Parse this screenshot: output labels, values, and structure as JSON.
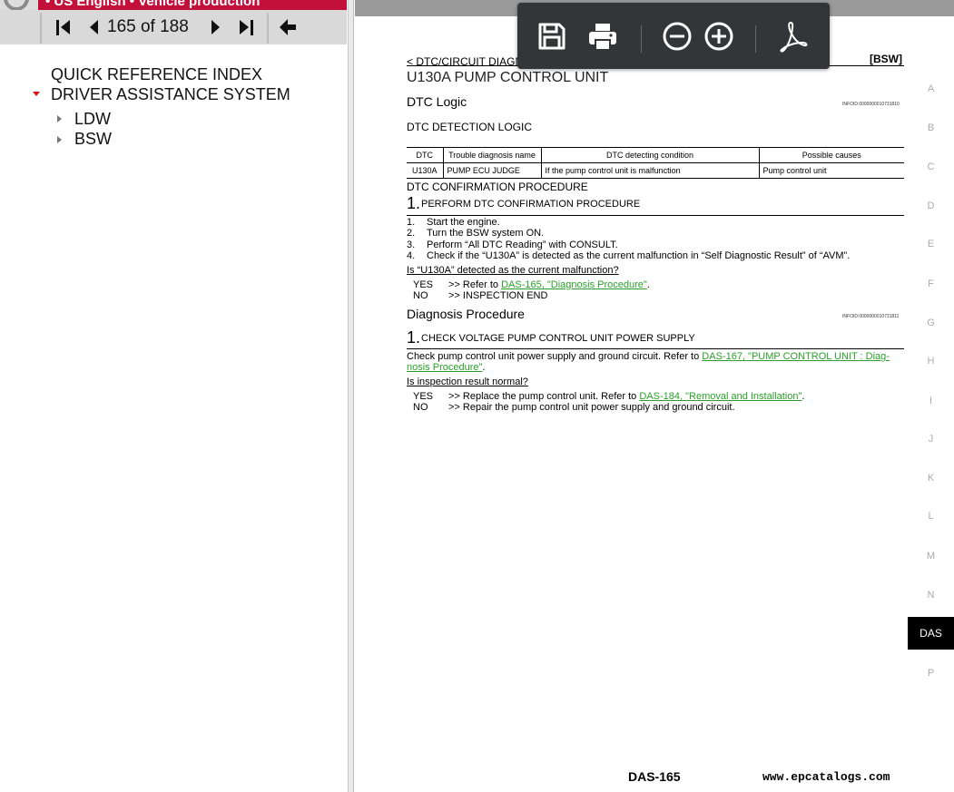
{
  "app": {
    "banner_text": "• US English • Vehicle production",
    "logo_icon": "nissan-logo"
  },
  "nav": {
    "first_icon": "first-page-icon",
    "prev_icon": "prev-page-icon",
    "page_indicator": "165 of 188",
    "next_icon": "next-page-icon",
    "last_icon": "last-page-icon",
    "back_icon": "back-arrow-icon"
  },
  "tree": {
    "items": [
      {
        "label": "QUICK REFERENCE INDEX"
      },
      {
        "label": "DRIVER ASSISTANCE SYSTEM",
        "expanded": true
      },
      {
        "label": "LDW"
      },
      {
        "label": "BSW"
      }
    ]
  },
  "toolbar": {
    "save_icon": "save-icon",
    "print_icon": "print-icon",
    "zoom_out_icon": "zoom-out-icon",
    "zoom_in_icon": "zoom-in-icon",
    "pdf_icon": "acrobat-icon"
  },
  "doc": {
    "breadcrumb": "< DTC/CIRCUIT DIAGNOSIS >",
    "section_tag": "[BSW]",
    "title": "U130A PUMP CONTROL UNIT",
    "dtc_logic": "DTC Logic",
    "infoid1": "INFOID:0000000010731810",
    "dtc_detection_logic": "DTC DETECTION LOGIC",
    "table": {
      "headers": [
        "DTC",
        "Trouble diagnosis name",
        "DTC detecting condition",
        "Possible causes"
      ],
      "rows": [
        [
          "U130A",
          "PUMP ECU JUDGE",
          "If the pump control unit is malfunction",
          "Pump control unit"
        ]
      ]
    },
    "confirm_proc": "DTC CONFIRMATION PROCEDURE",
    "step1_num": "1.",
    "step1_title": "PERFORM DTC CONFIRMATION PROCEDURE",
    "steps": [
      {
        "n": "1.",
        "t": "Start the engine."
      },
      {
        "n": "2.",
        "t": "Turn the BSW system ON."
      },
      {
        "n": "3.",
        "t": "Perform “All DTC Reading” with CONSULT."
      },
      {
        "n": "4.",
        "t": "Check if the “U130A” is detected as the current malfunction in “Self Diagnostic Result” of “AVM”."
      }
    ],
    "question1": "Is “U130A” detected as the current malfunction?",
    "yes1_label": "YES",
    "yes1_text": ">> Refer to",
    "yes1_link": "DAS-165, \"Diagnosis Procedure\"",
    "no1_label": "NO",
    "no1_text": ">> INSPECTION END",
    "diag_proc": "Diagnosis Procedure",
    "infoid2": "INFOID:0000000010731811",
    "step2_num": "1.",
    "step2_title": "CHECK VOLTAGE PUMP CONTROL UNIT POWER SUPPLY",
    "check_text": "Check pump control unit power supply and ground circuit. Refer to",
    "check_link1": "DAS-167, \"PUMP CONTROL UNIT : Diag-",
    "check_link2": "nosis Procedure\"",
    "question2": "Is inspection result normal?",
    "yes2_label": "YES",
    "yes2_text": ">> Replace the pump control unit. Refer to",
    "yes2_link": "DAS-184, \"Removal and Installation\"",
    "no2_label": "NO",
    "no2_text": ">> Repair the pump control unit power supply and ground circuit.",
    "page_number": "DAS-165",
    "watermark": "www.epcatalogs.com"
  },
  "side_tabs": [
    "A",
    "B",
    "C",
    "D",
    "E",
    "F",
    "G",
    "H",
    "I",
    "J",
    "K",
    "L",
    "M",
    "N",
    "DAS",
    "P"
  ],
  "active_tab": "DAS"
}
